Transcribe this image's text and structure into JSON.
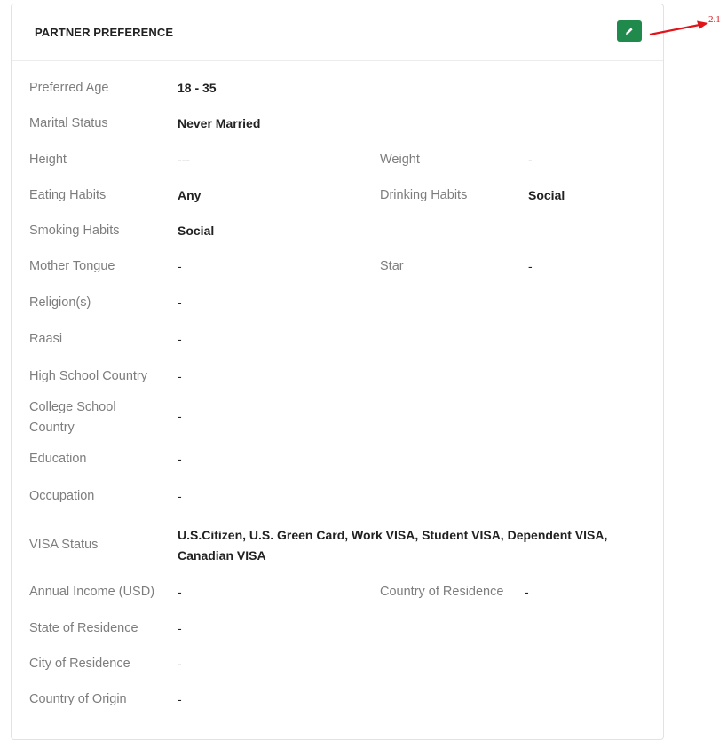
{
  "panel": {
    "title": "PARTNER PREFERENCE"
  },
  "annotation": {
    "label": "2.1",
    "color": "#e0141a"
  },
  "edit_icon": "pencil-icon",
  "accent_color": "#1f8a4c",
  "fields": {
    "preferred_age": {
      "label": "Preferred Age",
      "value": "18 - 35"
    },
    "marital_status": {
      "label": "Marital Status",
      "value": "Never Married"
    },
    "height": {
      "label": "Height",
      "value": "---"
    },
    "weight": {
      "label": "Weight",
      "value": "-"
    },
    "eating_habits": {
      "label": "Eating Habits",
      "value": "Any"
    },
    "drinking_habits": {
      "label": "Drinking Habits",
      "value": "Social"
    },
    "smoking_habits": {
      "label": "Smoking Habits",
      "value": "Social"
    },
    "mother_tongue": {
      "label": "Mother Tongue",
      "value": "-"
    },
    "star": {
      "label": "Star",
      "value": "-"
    },
    "religions": {
      "label": "Religion(s)",
      "value": "-"
    },
    "raasi": {
      "label": "Raasi",
      "value": "-"
    },
    "high_school_country": {
      "label": "High School Country",
      "value": "-"
    },
    "college_school_country_line1": {
      "label": "College School"
    },
    "college_school_country_line2": {
      "label": "Country"
    },
    "college_school_country": {
      "value": "-"
    },
    "education": {
      "label": "Education",
      "value": "-"
    },
    "occupation": {
      "label": "Occupation",
      "value": "-"
    },
    "visa_status": {
      "label": "VISA Status",
      "value_line1": "U.S.Citizen, U.S. Green Card, Work VISA, Student VISA, Dependent VISA,",
      "value_line2": "Canadian VISA"
    },
    "annual_income": {
      "label": "Annual Income (USD)",
      "value": "-"
    },
    "country_of_residence": {
      "label": "Country of Residence",
      "value": "-"
    },
    "state_of_residence": {
      "label": "State of Residence",
      "value": "-"
    },
    "city_of_residence": {
      "label": "City of Residence",
      "value": "-"
    },
    "country_of_origin": {
      "label": "Country of Origin",
      "value": "-"
    }
  }
}
